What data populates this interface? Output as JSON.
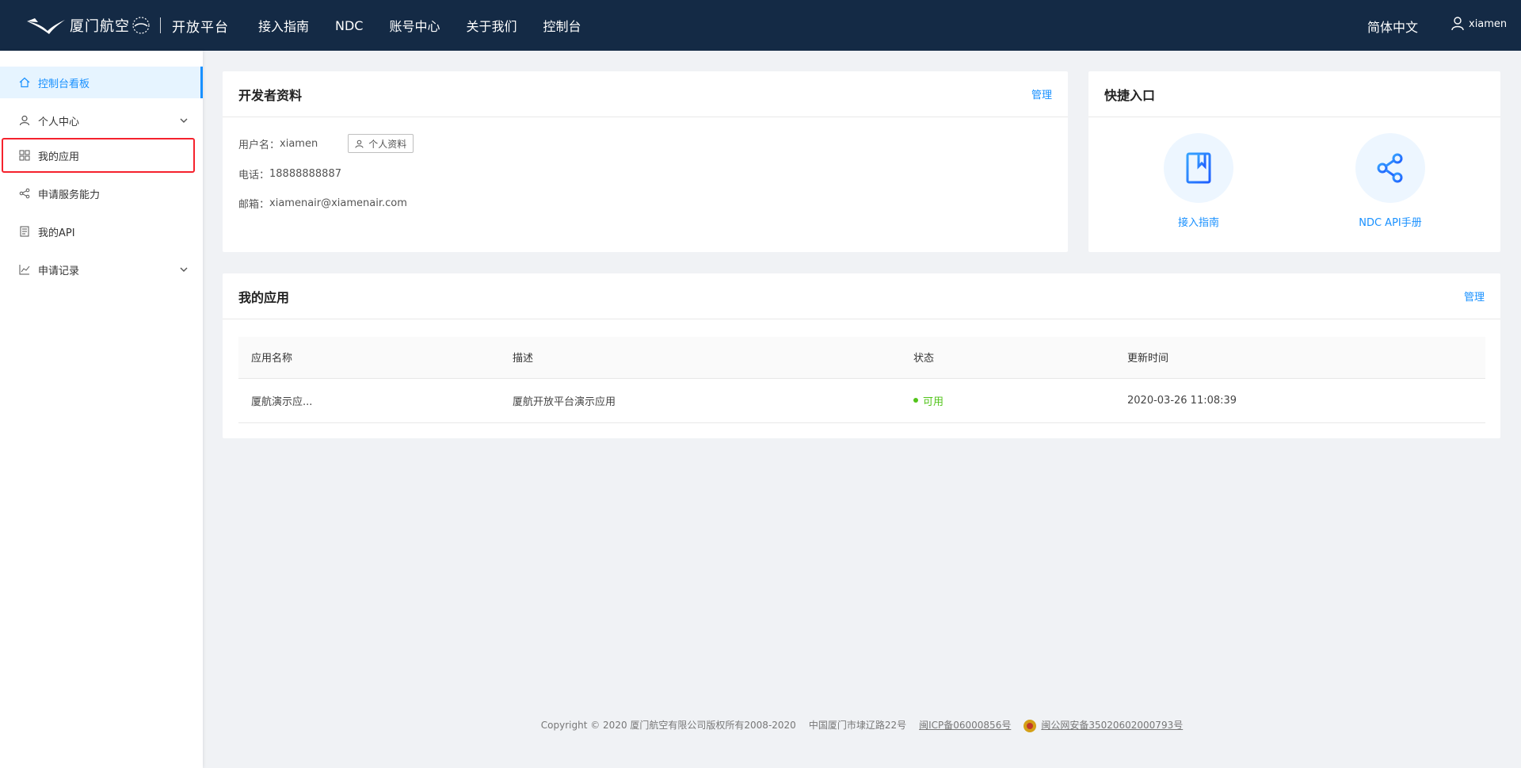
{
  "header": {
    "brand_name": "厦门航空",
    "platform": "开放平台",
    "nav": [
      "接入指南",
      "NDC",
      "账号中心",
      "关于我们",
      "控制台"
    ],
    "language": "简体中文",
    "username": "xiamen"
  },
  "sidebar": {
    "items": [
      {
        "label": "控制台看板",
        "icon": "home-icon",
        "active": true
      },
      {
        "label": "个人中心",
        "icon": "user-icon",
        "expandable": true
      },
      {
        "label": "我的应用",
        "icon": "grid-icon",
        "highlighted": true
      },
      {
        "label": "申请服务能力",
        "icon": "share-icon"
      },
      {
        "label": "我的API",
        "icon": "book-icon"
      },
      {
        "label": "申请记录",
        "icon": "chart-line-icon",
        "expandable": true
      }
    ]
  },
  "developer": {
    "title": "开发者资料",
    "manage": "管理",
    "username_label": "用户名：",
    "username": "xiamen",
    "profile_button": "个人资料",
    "phone_label": "电话：",
    "phone": "18888888887",
    "email_label": "邮箱：",
    "email": "xiamenair@xiamenair.com"
  },
  "quick": {
    "title": "快捷入口",
    "items": [
      {
        "label": "接入指南",
        "icon": "book-icon"
      },
      {
        "label": "NDC API手册",
        "icon": "share-icon"
      }
    ]
  },
  "apps": {
    "title": "我的应用",
    "manage": "管理",
    "columns": [
      "应用名称",
      "描述",
      "状态",
      "更新时间"
    ],
    "rows": [
      {
        "name": "厦航演示应...",
        "desc": "厦航开放平台演示应用",
        "status": "可用",
        "updated": "2020-03-26 11:08:39"
      }
    ]
  },
  "footer": {
    "copyright": "Copyright © 2020 厦门航空有限公司版权所有2008-2020",
    "address": "中国厦门市埭辽路22号",
    "icp": "闽ICP备06000856号",
    "police": "闽公网安备35020602000793号"
  },
  "colors": {
    "header_bg": "#142a45",
    "accent": "#1890ff",
    "success": "#52c41a",
    "highlight_border": "#f5222d"
  }
}
